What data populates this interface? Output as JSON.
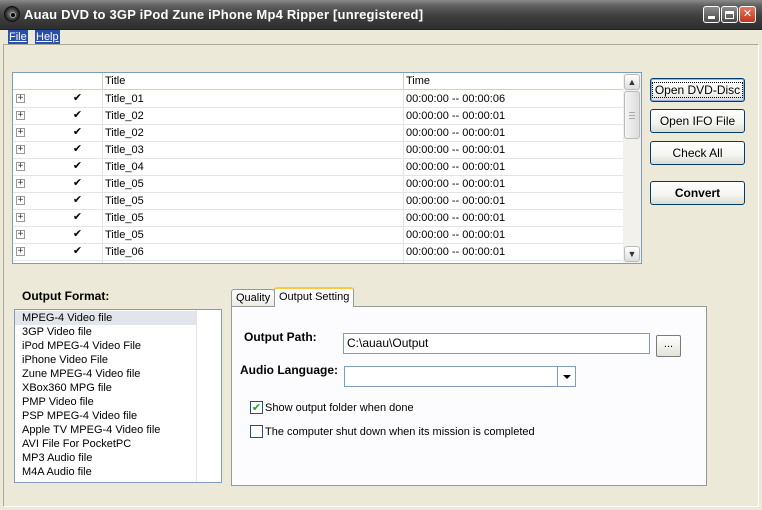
{
  "window": {
    "title": "Auau DVD to 3GP iPod Zune iPhone Mp4 Ripper  [unregistered]",
    "min_glyph": "_",
    "close_glyph": "✕"
  },
  "menu": {
    "file": "File",
    "help": "Help"
  },
  "titles_list": {
    "columns": {
      "title": "Title",
      "time": "Time"
    },
    "expander_glyph": "+",
    "check_glyph": "✔",
    "rows": [
      {
        "title": "Title_01",
        "time": "00:00:00 -- 00:00:06",
        "checked": true
      },
      {
        "title": "Title_02",
        "time": "00:00:00 -- 00:00:01",
        "checked": true
      },
      {
        "title": "Title_02",
        "time": "00:00:00 -- 00:00:01",
        "checked": true
      },
      {
        "title": "Title_03",
        "time": "00:00:00 -- 00:00:01",
        "checked": true
      },
      {
        "title": "Title_04",
        "time": "00:00:00 -- 00:00:01",
        "checked": true
      },
      {
        "title": "Title_05",
        "time": "00:00:00 -- 00:00:01",
        "checked": true
      },
      {
        "title": "Title_05",
        "time": "00:00:00 -- 00:00:01",
        "checked": true
      },
      {
        "title": "Title_05",
        "time": "00:00:00 -- 00:00:01",
        "checked": true
      },
      {
        "title": "Title_05",
        "time": "00:00:00 -- 00:00:01",
        "checked": true
      },
      {
        "title": "Title_06",
        "time": "00:00:00 -- 00:00:01",
        "checked": true
      }
    ],
    "scroll_up_glyph": "▲",
    "scroll_down_glyph": "▼"
  },
  "buttons": {
    "open_dvd": "Open DVD-Disc",
    "open_ifo": "Open IFO File",
    "check_all": "Check All",
    "convert": "Convert"
  },
  "output_format": {
    "label": "Output Format:",
    "items": [
      "MPEG-4 Video file",
      "3GP Video file",
      "iPod MPEG-4 Video File",
      "iPhone Video File",
      "Zune MPEG-4 Video file",
      "XBox360 MPG file",
      "PMP Video file",
      "PSP MPEG-4 Video file",
      "Apple TV MPEG-4 Video file",
      "AVI File For PocketPC",
      "MP3 Audio file",
      "M4A Audio file"
    ],
    "selected_index": 0
  },
  "tabs": {
    "quality": "Quality",
    "output_setting": "Output Setting"
  },
  "output_setting": {
    "output_path_label": "Output Path:",
    "output_path_value": "C:\\auau\\Output",
    "browse_label": "...",
    "audio_language_label": "Audio Language:",
    "audio_language_value": "",
    "show_folder_label": "Show output folder when done",
    "show_folder_checked": true,
    "shutdown_label": "The computer shut down when its mission is completed",
    "shutdown_checked": false
  },
  "colors": {
    "title_bar": "#3f3f3f",
    "menu_highlight": "#2a4fa8",
    "window_bg": "#ece9d8",
    "tab_active_accent": "#ffc83c",
    "check_green": "#21a121"
  }
}
